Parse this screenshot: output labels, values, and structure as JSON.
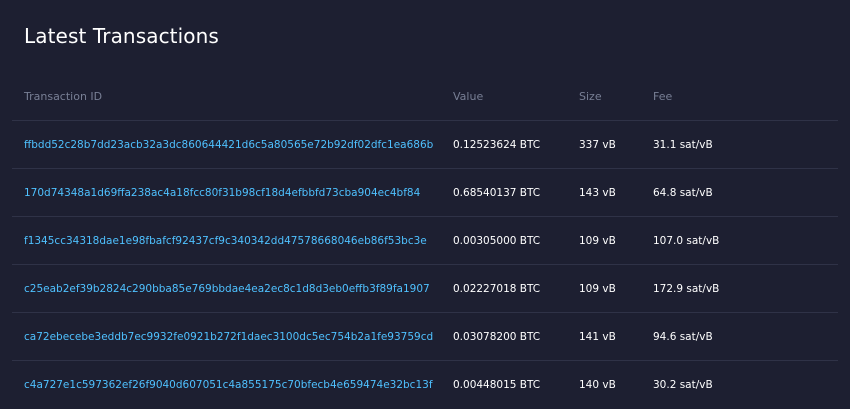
{
  "panel": {
    "title": "Latest Transactions"
  },
  "table": {
    "headers": {
      "txid": "Transaction ID",
      "value": "Value",
      "size": "Size",
      "fee": "Fee"
    },
    "rows": [
      {
        "txid": "ffbdd52c28b7dd23acb32a3dc860644421d6c5a80565e72b92df02dfc1ea686b",
        "value": "0.12523624 BTC",
        "size": "337 vB",
        "fee": "31.1 sat/vB"
      },
      {
        "txid": "170d74348a1d69ffa238ac4a18fcc80f31b98cf18d4efbbfd73cba904ec4bf84",
        "value": "0.68540137 BTC",
        "size": "143 vB",
        "fee": "64.8 sat/vB"
      },
      {
        "txid": "f1345cc34318dae1e98fbafcf92437cf9c340342dd47578668046eb86f53bc3e",
        "value": "0.00305000 BTC",
        "size": "109 vB",
        "fee": "107.0 sat/vB"
      },
      {
        "txid": "c25eab2ef39b2824c290bba85e769bbdae4ea2ec8c1d8d3eb0effb3f89fa1907",
        "value": "0.02227018 BTC",
        "size": "109 vB",
        "fee": "172.9 sat/vB"
      },
      {
        "txid": "ca72ebecebe3eddb7ec9932fe0921b272f1daec3100dc5ec754b2a1fe93759cd",
        "value": "0.03078200 BTC",
        "size": "141 vB",
        "fee": "94.6 sat/vB"
      },
      {
        "txid": "c4a727e1c597362ef26f9040d607051c4a855175c70bfecb4e659474e32bc13f",
        "value": "0.00448015 BTC",
        "size": "140 vB",
        "fee": "30.2 sat/vB"
      }
    ]
  },
  "colors": {
    "background": "#1d1f31",
    "link": "#4fc1ff",
    "header_text": "#787f95",
    "divider": "#2f3247"
  }
}
